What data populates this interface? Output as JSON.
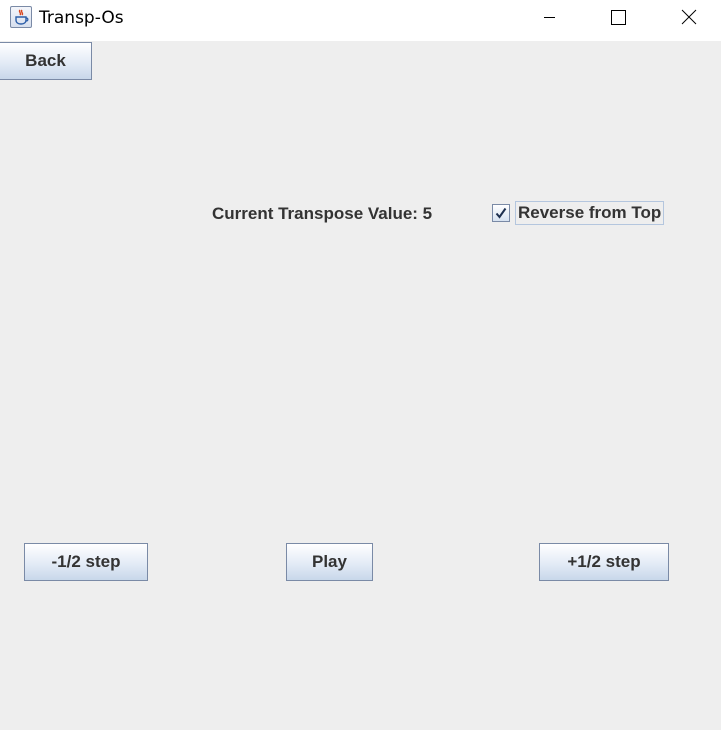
{
  "window": {
    "title": "Transp-Os",
    "app_icon": "java-cup-icon",
    "controls": {
      "minimize_icon": "minimize-icon",
      "maximize_icon": "maximize-icon",
      "close_icon": "close-icon"
    }
  },
  "nav": {
    "back_label": "Back"
  },
  "transpose": {
    "label": "Current Transpose Value: 5"
  },
  "reverse": {
    "label": "Reverse from Top",
    "checked": true
  },
  "controls": {
    "minus_label": "-1/2 step",
    "play_label": "Play",
    "plus_label": "+1/2 step"
  },
  "colors": {
    "background": "#eeeeee",
    "titlebar": "#ffffff",
    "button_border": "#7a8aa6",
    "text": "#333333"
  }
}
